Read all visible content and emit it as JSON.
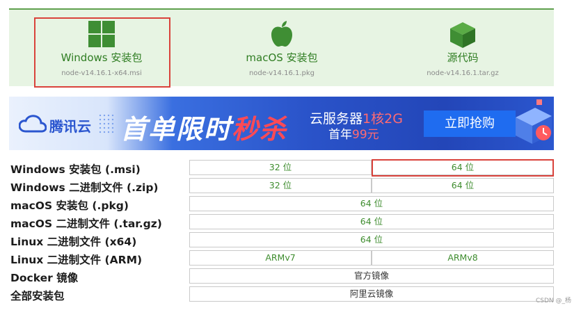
{
  "downloads": [
    {
      "label": "Windows 安装包",
      "file": "node-v14.16.1-x64.msi",
      "icon": "windows-icon"
    },
    {
      "label": "macOS 安装包",
      "file": "node-v14.16.1.pkg",
      "icon": "apple-icon"
    },
    {
      "label": "源代码",
      "file": "node-v14.16.1.tar.gz",
      "icon": "box-icon"
    }
  ],
  "banner": {
    "brand": "腾讯云",
    "headline_a": "首单限时",
    "headline_b": "秒杀",
    "promo_line1_a": "云服务器",
    "promo_line1_b": "1核2G",
    "promo_line2_a": "首年",
    "promo_line2_b": "99元",
    "cta": "立即抢购"
  },
  "table": [
    {
      "label": "Windows 安装包 (.msi)",
      "cells": [
        "32 位",
        "64 位"
      ]
    },
    {
      "label": "Windows 二进制文件 (.zip)",
      "cells": [
        "32 位",
        "64 位"
      ]
    },
    {
      "label": "macOS 安装包 (.pkg)",
      "cells": [
        "64 位"
      ]
    },
    {
      "label": "macOS 二进制文件 (.tar.gz)",
      "cells": [
        "64 位"
      ]
    },
    {
      "label": "Linux 二进制文件 (x64)",
      "cells": [
        "64 位"
      ]
    },
    {
      "label": "Linux 二进制文件 (ARM)",
      "cells": [
        "ARMv7",
        "ARMv8"
      ]
    },
    {
      "label": "Docker 镜像",
      "cells": [
        "官方镜像"
      ]
    },
    {
      "label": "全部安装包",
      "cells": [
        "阿里云镜像"
      ]
    }
  ],
  "watermark": "CSDN @_杨",
  "colors": {
    "accent_green": "#3e8c2e",
    "highlight_red": "#d9423b",
    "panel_bg": "#e7f4e3"
  }
}
